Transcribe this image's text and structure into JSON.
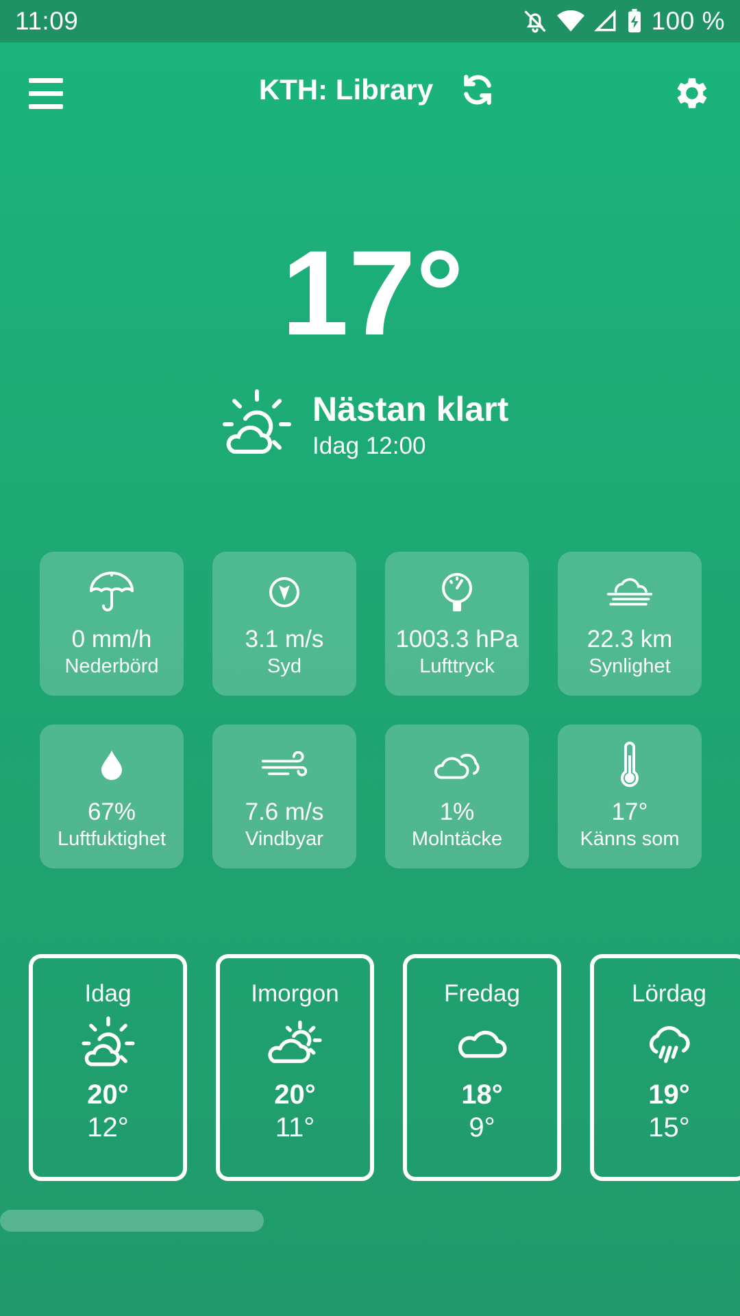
{
  "status_bar": {
    "time": "11:09",
    "battery": "100 %",
    "icons": [
      "bell-off-icon",
      "wifi-icon",
      "signal-icon",
      "battery-charging-icon"
    ]
  },
  "app_bar": {
    "title": "KTH: Library",
    "icons": [
      "menu-icon",
      "refresh-icon",
      "gear-icon"
    ]
  },
  "current": {
    "temperature": "17°",
    "condition": "Nästan klart",
    "time": "Idag 12:00",
    "icon": "partly-sunny-icon"
  },
  "details": [
    {
      "icon": "umbrella-icon",
      "value": "0 mm/h",
      "label": "Nederbörd"
    },
    {
      "icon": "compass-icon",
      "value": "3.1 m/s",
      "label": "Syd"
    },
    {
      "icon": "gauge-icon",
      "value": "1003.3 hPa",
      "label": "Lufttryck"
    },
    {
      "icon": "fog-icon",
      "value": "22.3 km",
      "label": "Synlighet"
    },
    {
      "icon": "droplet-icon",
      "value": "67%",
      "label": "Luftfuktighet"
    },
    {
      "icon": "wind-icon",
      "value": "7.6 m/s",
      "label": "Vindbyar"
    },
    {
      "icon": "cloud-icon",
      "value": "1%",
      "label": "Molntäcke"
    },
    {
      "icon": "thermometer-icon",
      "value": "17°",
      "label": "Känns som"
    }
  ],
  "forecast": [
    {
      "day": "Idag",
      "icon": "partly-sunny-icon",
      "high": "20°",
      "low": "12°"
    },
    {
      "day": "Imorgon",
      "icon": "mostly-cloudy-icon",
      "high": "20°",
      "low": "11°"
    },
    {
      "day": "Fredag",
      "icon": "cloud-icon",
      "high": "18°",
      "low": "9°"
    },
    {
      "day": "Lördag",
      "icon": "rain-icon",
      "high": "19°",
      "low": "15°"
    }
  ]
}
